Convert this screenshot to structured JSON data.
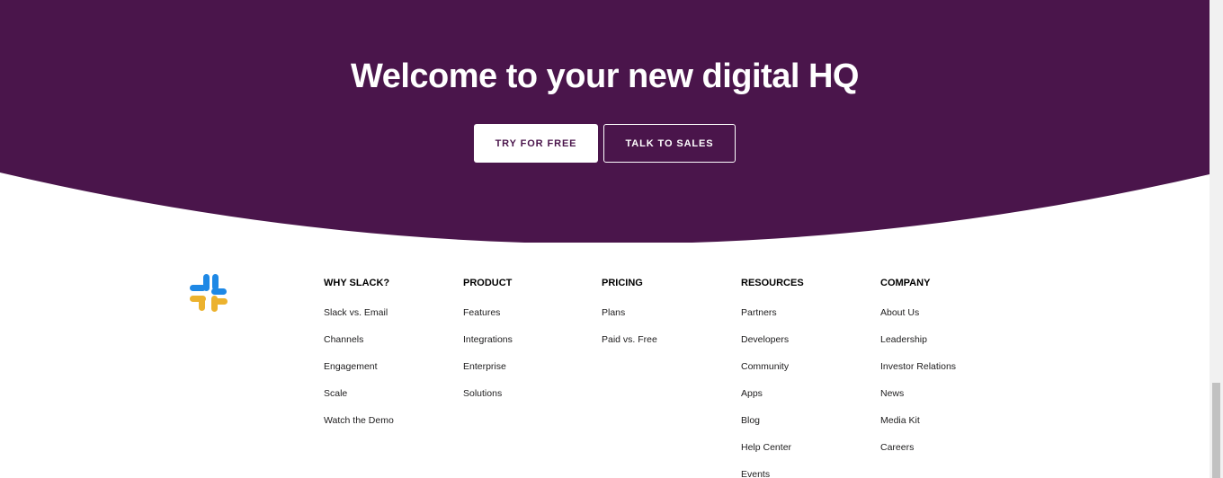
{
  "colors": {
    "aubergine": "#4a154b",
    "logo_blue": "#1e88e5",
    "logo_yellow": "#ecb22e"
  },
  "hero": {
    "title": "Welcome to your new digital HQ",
    "primary_button": "TRY FOR FREE",
    "secondary_button": "TALK TO SALES"
  },
  "logo": {
    "icon": "slack-logo-icon"
  },
  "footer": {
    "columns": [
      {
        "heading": "WHY SLACK?",
        "links": [
          "Slack vs. Email",
          "Channels",
          "Engagement",
          "Scale",
          "Watch the Demo"
        ]
      },
      {
        "heading": "PRODUCT",
        "links": [
          "Features",
          "Integrations",
          "Enterprise",
          "Solutions"
        ]
      },
      {
        "heading": "PRICING",
        "links": [
          "Plans",
          "Paid vs. Free"
        ]
      },
      {
        "heading": "RESOURCES",
        "links": [
          "Partners",
          "Developers",
          "Community",
          "Apps",
          "Blog",
          "Help Center",
          "Events"
        ]
      },
      {
        "heading": "COMPANY",
        "links": [
          "About Us",
          "Leadership",
          "Investor Relations",
          "News",
          "Media Kit",
          "Careers"
        ]
      }
    ]
  }
}
